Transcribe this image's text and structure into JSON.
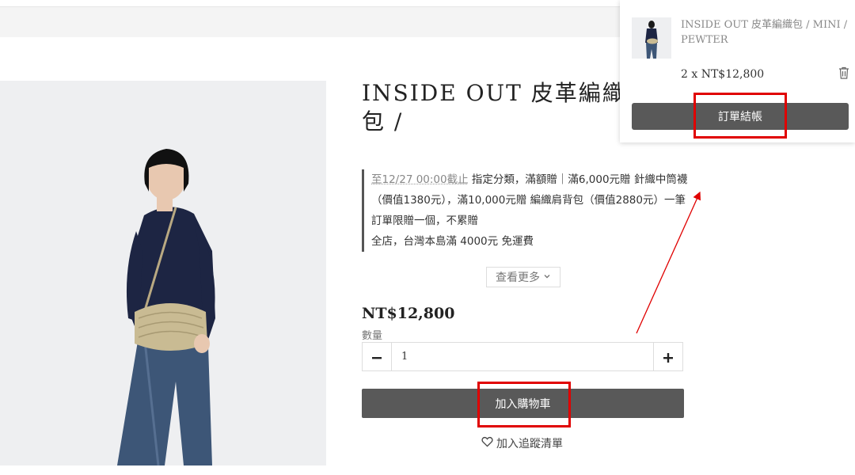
{
  "product": {
    "title": "INSIDE OUT 皮革編織包 /\nMINI / PEWTER",
    "promo_date": "至12/27 00:00截止",
    "promo_line1": " 指定分類，滿額贈｜滿6,000元贈 針織中筒襪（價值1380元），滿10,000元贈 編織肩背包（價值2880元）一筆訂單限贈一個，不累贈",
    "promo_line2": "全店，台灣本島滿 4000元 免運費",
    "see_more": "查看更多",
    "price": "NT$12,800",
    "qty_label": "數量",
    "qty_value": "1",
    "add_to_cart": "加入購物車",
    "wishlist": "加入追蹤清單"
  },
  "minicart": {
    "item_name": "INSIDE OUT 皮革編織包 / MINI / PEWTER",
    "item_qty_price": "2 x  NT$12,800",
    "checkout": "訂單結帳"
  },
  "icons": {
    "see_more": "chevron-down-icon",
    "minus": "minus-icon",
    "plus": "plus-icon",
    "wishlist": "heart-icon",
    "remove": "trash-icon"
  },
  "colors": {
    "button_bg": "#595959",
    "highlight": "#e00000"
  }
}
